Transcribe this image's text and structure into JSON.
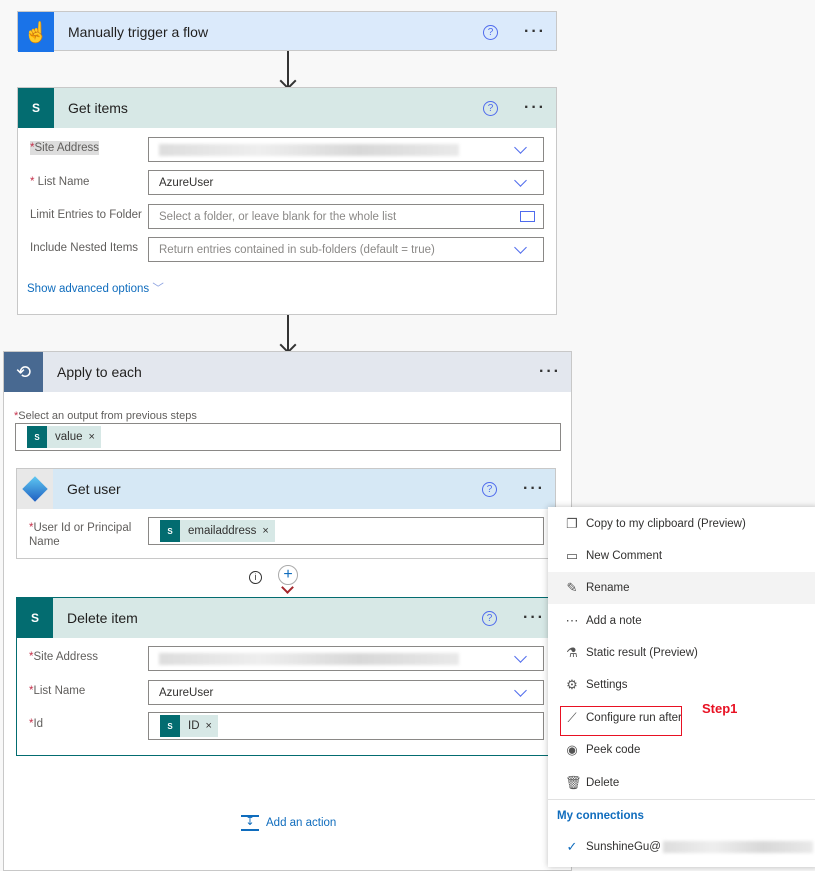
{
  "trigger": {
    "title": "Manually trigger a flow",
    "icon": "touch-hand-icon"
  },
  "get_items": {
    "title": "Get items",
    "fields": [
      {
        "label": "Site Address",
        "required": true,
        "value": ""
      },
      {
        "label": "List Name",
        "required": true,
        "value": "AzureUser"
      },
      {
        "label": "Limit Entries to Folder",
        "required": false,
        "placeholder": "Select a folder, or leave blank for the whole list"
      },
      {
        "label": "Include Nested Items",
        "required": false,
        "placeholder": "Return entries contained in sub-folders (default = true)"
      }
    ],
    "advanced": "Show advanced options"
  },
  "apply_each": {
    "title": "Apply to each",
    "label": "Select an output from previous steps",
    "token": "value"
  },
  "get_user": {
    "title": "Get user",
    "label": "User Id or Principal Name",
    "token": "emailaddress"
  },
  "delete_item": {
    "title": "Delete item",
    "fields": [
      {
        "label": "Site Address",
        "value": ""
      },
      {
        "label": "List Name",
        "value": "AzureUser"
      },
      {
        "label": "Id",
        "token": "ID"
      }
    ]
  },
  "add_action": "Add an action",
  "menu": {
    "items": [
      {
        "label": "Copy to my clipboard (Preview)",
        "icon": "copy-icon"
      },
      {
        "label": "New Comment",
        "icon": "comment-icon"
      },
      {
        "label": "Rename",
        "icon": "pencil-icon"
      },
      {
        "label": "Add a note",
        "icon": "note-icon"
      },
      {
        "label": "Static result (Preview)",
        "icon": "flask-icon"
      },
      {
        "label": "Settings",
        "icon": "gear-icon"
      },
      {
        "label": "Configure run after",
        "icon": "run-after-icon"
      },
      {
        "label": "Peek code",
        "icon": "eye-icon"
      },
      {
        "label": "Delete",
        "icon": "trash-icon"
      }
    ],
    "connections_title": "My connections",
    "connection_user": "SunshineGu@"
  },
  "annotation": "Step1",
  "colors": {
    "accent": "#4f6bed",
    "sharepoint": "#036c70",
    "trigger": "#1a73e8",
    "loop": "#486991",
    "annotation": "#e81123"
  }
}
